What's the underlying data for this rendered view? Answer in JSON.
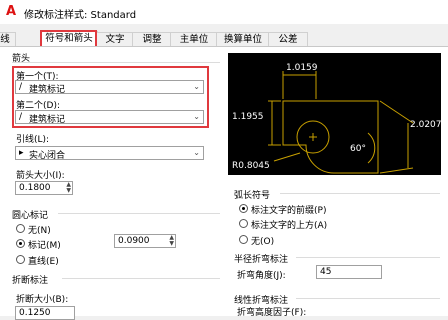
{
  "window": {
    "title": "修改标注样式: Standard",
    "app_icon": "autocad-a-icon"
  },
  "tabs": [
    "线",
    "符号和箭头",
    "文字",
    "调整",
    "主单位",
    "换算单位",
    "公差"
  ],
  "active_tab": "符号和箭头",
  "arrowheads": {
    "group_label": "箭头",
    "first_label": "第一个(T):",
    "first_value": "建筑标记",
    "second_label": "第二个(D):",
    "second_value": "建筑标记",
    "leader_label": "引线(L):",
    "leader_value": "实心闭合",
    "size_label": "箭头大小(I):",
    "size_value": "0.1800"
  },
  "center_marks": {
    "group_label": "圆心标记",
    "options": [
      "无(N)",
      "标记(M)",
      "直线(E)"
    ],
    "selected": "标记(M)",
    "size_value": "0.0900"
  },
  "break": {
    "group_label": "折断标注",
    "size_label": "折断大小(B):",
    "size_value": "0.1250"
  },
  "arc_length": {
    "group_label": "弧长符号",
    "options": [
      "标注文字的前缀(P)",
      "标注文字的上方(A)",
      "无(O)"
    ],
    "selected": "标注文字的前缀(P)"
  },
  "radius_jog": {
    "group_label": "半径折弯标注",
    "angle_label": "折弯角度(J):",
    "angle_value": "45"
  },
  "linear_jog": {
    "group_label": "线性折弯标注",
    "factor_label": "折弯高度因子(F):"
  },
  "preview": {
    "dims": [
      "1.0159",
      "1.1955",
      "2.0207",
      "R0.8045",
      "60°"
    ],
    "line_color": "#c8a000",
    "text_color": "#ffffff",
    "bg_color": "#000000"
  },
  "colors": {
    "highlight": "#e0393e"
  }
}
